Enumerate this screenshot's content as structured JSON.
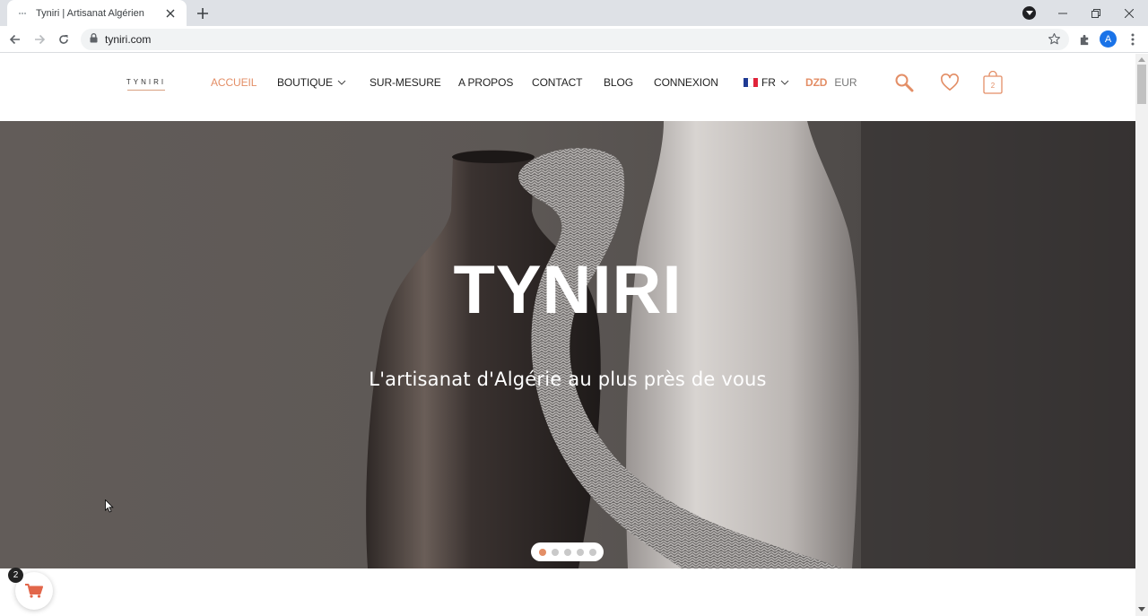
{
  "browser": {
    "tab_title": "Tyniri | Artisanat Algérien",
    "url": "tyniri.com",
    "profile_initial": "A",
    "icons": [
      "favicon-icon",
      "close-icon",
      "plus-icon",
      "back-icon",
      "forward-icon",
      "reload-icon",
      "lock-icon",
      "star-icon",
      "extensions-icon",
      "menu-icon",
      "minimize-icon",
      "maximize-icon",
      "close-window-icon"
    ]
  },
  "header": {
    "logo": "TYNIRI",
    "menu": {
      "accueil": "ACCUEIL",
      "boutique": "BOUTIQUE",
      "sur_mesure": "SUR-MESURE",
      "a_propos": "A PROPOS",
      "contact": "CONTACT",
      "blog": "BLOG",
      "connexion": "CONNEXION",
      "lang": "FR"
    },
    "currency": {
      "active": "DZD",
      "other": "EUR"
    },
    "cart_count": "2"
  },
  "hero": {
    "title": "TYNIRI",
    "subtitle": "L'artisanat d'Algérie au plus près de vous",
    "slides_total": 5,
    "slide_active": 1
  },
  "floating_cart": {
    "count": "2"
  },
  "colors": {
    "accent": "#e38e66",
    "text": "#222222",
    "chrome": "#dee1e6"
  }
}
